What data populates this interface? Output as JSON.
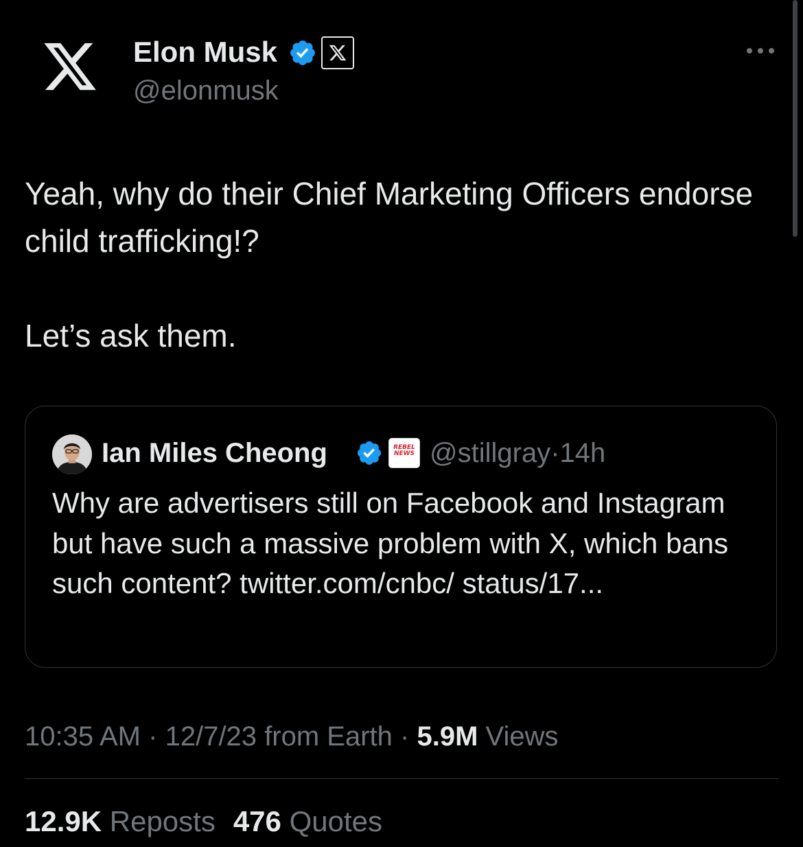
{
  "author": {
    "name": "Elon Musk",
    "handle": "@elonmusk",
    "avatar_icon": "x-logo-icon",
    "verified_icon": "verified-badge-icon",
    "affiliate_icon": "x-logo-icon"
  },
  "more_icon": "more-horizontal-icon",
  "tweet": {
    "paragraphs": [
      "Yeah, why do their Chief Marketing Officers endorse child trafficking!?",
      "Let’s ask them."
    ]
  },
  "quote": {
    "author_name": "Ian Miles Cheong",
    "verified_icon": "verified-badge-icon",
    "affiliate_label": "REBEL NEWS",
    "handle": "@stillgray",
    "separator": "·",
    "time": "14h",
    "text": "Why are advertisers still on Facebook and Instagram but have such a massive problem with X, which bans such content? twitter.com/cnbc/ status/17..."
  },
  "meta": {
    "time": "10:35 AM",
    "separator": "·",
    "date": "12/7/23",
    "source": "from Earth",
    "views_count": "5.9M",
    "views_label": "Views"
  },
  "stats": {
    "reposts_count": "12.9K",
    "reposts_label": "Reposts",
    "quotes_count": "476",
    "quotes_label": "Quotes"
  },
  "colors": {
    "background": "#000000",
    "text_primary": "#e7e9ea",
    "text_secondary": "#71767b",
    "verified_blue": "#1d9bf0",
    "border": "#2f3336",
    "rebel_red": "#d9232e"
  }
}
